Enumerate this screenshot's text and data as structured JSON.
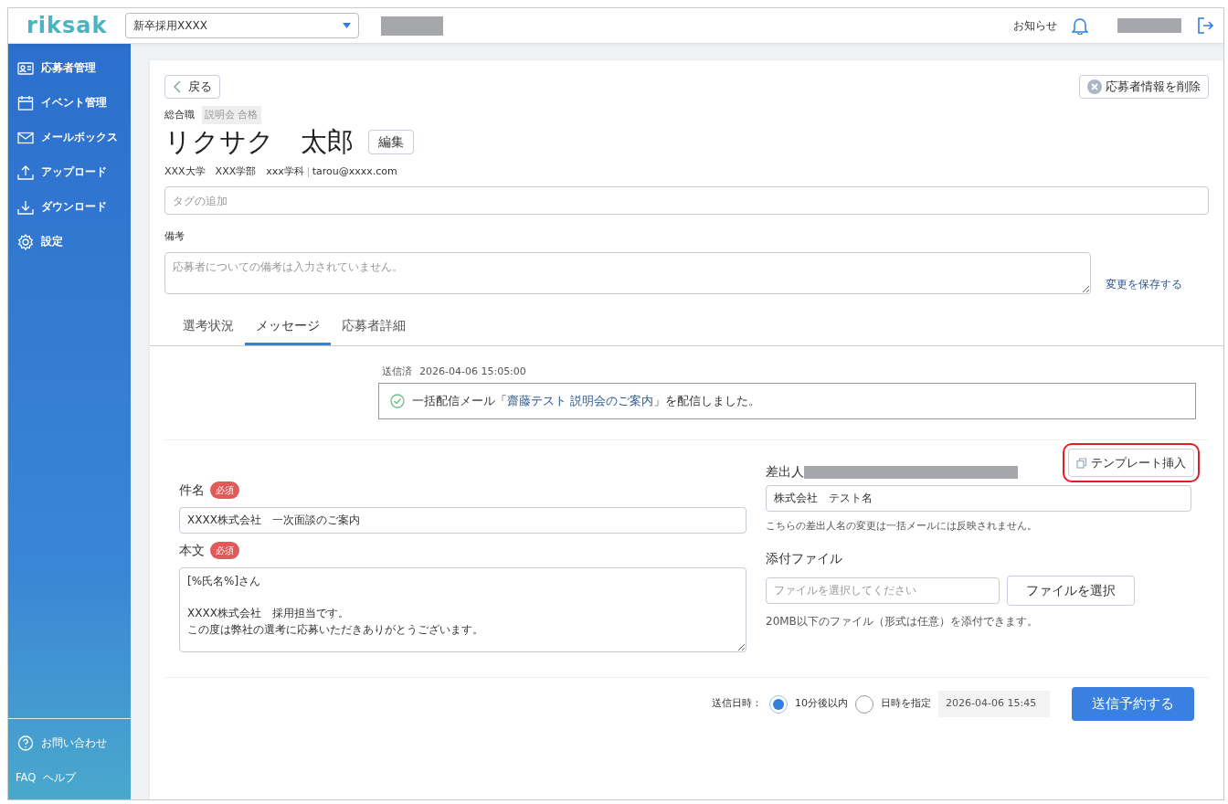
{
  "header": {
    "logo": "riksak",
    "recruitment_select": {
      "value": "新卒採用XXXX"
    },
    "notice_label": "お知らせ"
  },
  "sidebar": {
    "items": [
      {
        "label": "応募者管理"
      },
      {
        "label": "イベント管理"
      },
      {
        "label": "メールボックス"
      },
      {
        "label": "アップロード"
      },
      {
        "label": "ダウンロード"
      },
      {
        "label": "設定"
      }
    ],
    "footer_items": [
      {
        "label": "お問い合わせ"
      },
      {
        "badge": "FAQ",
        "label": "ヘルプ"
      }
    ]
  },
  "applicant": {
    "back_button": "戻る",
    "delete_button": "応募者情報を削除",
    "job": "総合職",
    "status_tag": "説明会 合格",
    "name": "リクサク　太郎",
    "edit_button": "編集",
    "profile": "XXX大学　XXX学部　xxx学科",
    "email": "tarou@xxxx.com",
    "tag_field": {
      "placeholder": "タグの追加"
    },
    "notes_label": "備考",
    "notes_field": {
      "placeholder": "応募者についての備考は入力されていません。"
    },
    "save_link": "変更を保存する"
  },
  "tabs": [
    {
      "label": "選考状況",
      "selected": false
    },
    {
      "label": "メッセージ",
      "selected": true
    },
    {
      "label": "応募者詳細",
      "selected": false
    }
  ],
  "sent_message": {
    "status": "送信済",
    "datetime": "2026-04-06 15:05:00",
    "text_before": "一括配信メール「",
    "link": "齋藤テスト 説明会のご案内",
    "text_after": "」を配信しました。"
  },
  "compose": {
    "template_button": "テンプレート挿入",
    "template_highlighted": true,
    "subject": {
      "label": "件名",
      "required_badge": "必須",
      "value": "XXXX株式会社　一次面談のご案内"
    },
    "body": {
      "label": "本文",
      "required_badge": "必須",
      "paragraphs": [
        [
          "[%氏名%]さん"
        ],
        [
          "XXXX株式会社　採用担当です。",
          "この度は弊社の選考に応募いただきありがとうございます。"
        ]
      ]
    },
    "sender": {
      "label": "差出人",
      "value": "株式会社　テスト名",
      "note": "こちらの差出人名の変更は一括メールには反映されません。"
    },
    "attachment": {
      "label": "添付ファイル",
      "placeholder": "ファイルを選択してください",
      "button": "ファイルを選択",
      "note": "20MB以下のファイル（形式は任意）を添付できます。"
    }
  },
  "schedule": {
    "label": "送信日時：",
    "options": [
      {
        "label": "10分後以内",
        "selected": true
      },
      {
        "label": "日時を指定",
        "selected": false
      }
    ],
    "datetime_field": {
      "value": "2026-04-06 15:45",
      "disabled": true
    },
    "submit_button": "送信予約する"
  }
}
